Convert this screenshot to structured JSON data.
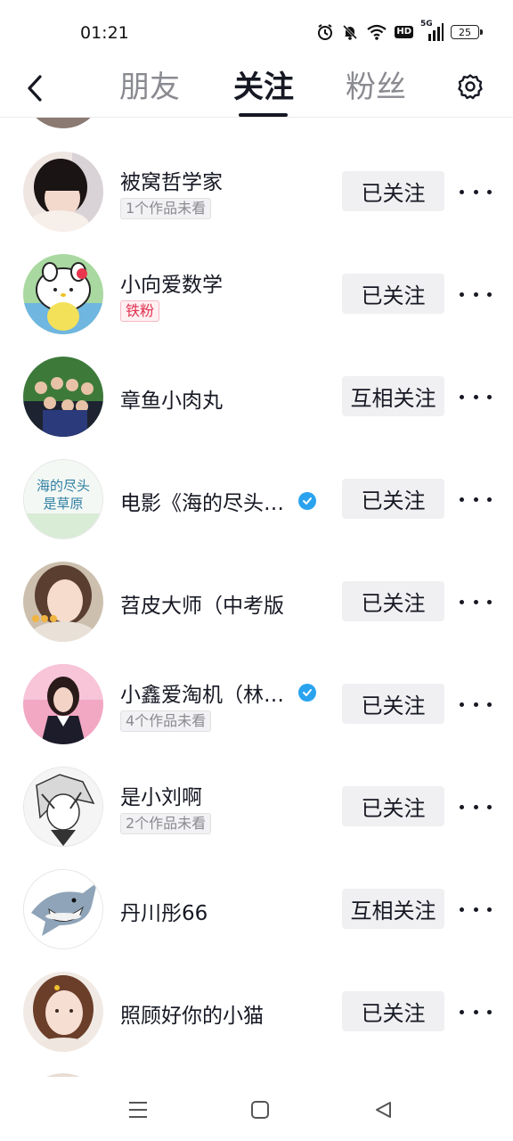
{
  "status_bar": {
    "time": "01:21",
    "signal_label": "5G",
    "hd_label": "HD",
    "battery": "25",
    "icons": [
      "alarm-icon",
      "mute-icon",
      "wifi-icon",
      "hd-icon",
      "signal-icon",
      "battery-icon"
    ]
  },
  "header": {
    "tabs": [
      {
        "label": "朋友",
        "active": false
      },
      {
        "label": "关注",
        "active": true
      },
      {
        "label": "粉丝",
        "active": false
      }
    ]
  },
  "rows": [
    {
      "name": "被窝哲学家",
      "tag": "1个作品未看",
      "tag_style": "gray",
      "verified": false,
      "button": "已关注"
    },
    {
      "name": "小向爱数学",
      "tag": "铁粉",
      "tag_style": "red",
      "verified": false,
      "button": "已关注"
    },
    {
      "name": "章鱼小肉丸",
      "tag": "",
      "tag_style": "",
      "verified": false,
      "button": "互相关注"
    },
    {
      "name": "电影《海的尽头…",
      "tag": "",
      "tag_style": "",
      "verified": true,
      "button": "已关注"
    },
    {
      "name": "苕皮大师（中考版",
      "tag": "",
      "tag_style": "",
      "verified": false,
      "button": "已关注"
    },
    {
      "name": "小鑫爱淘机（林…",
      "tag": "4个作品未看",
      "tag_style": "gray",
      "verified": true,
      "button": "已关注"
    },
    {
      "name": "是小刘啊",
      "tag": "2个作品未看",
      "tag_style": "gray",
      "verified": false,
      "button": "已关注"
    },
    {
      "name": "丹川彤66",
      "tag": "",
      "tag_style": "",
      "verified": false,
      "button": "互相关注"
    },
    {
      "name": "照顾好你的小猫",
      "tag": "",
      "tag_style": "",
      "verified": false,
      "button": "已关注"
    }
  ],
  "avatar_poster_text": {
    "line1": "海的尽头",
    "line2": "是草原"
  },
  "colors": {
    "accent_text": "#161823",
    "inactive_tab": "#8a8b91",
    "button_bg": "#f0f0f2",
    "verified_blue": "#2aa3ef",
    "fan_tag_red": "#e0304e"
  }
}
